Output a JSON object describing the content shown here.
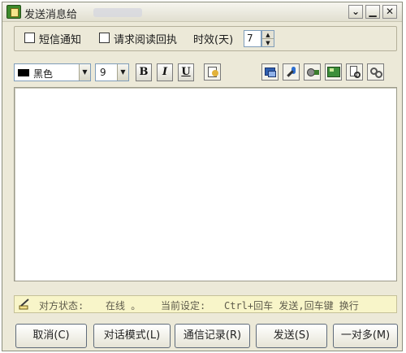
{
  "window": {
    "title": "发送消息给",
    "controls": {
      "menu_glyph": "⌄",
      "minimize_glyph": "▁",
      "close_glyph": "✕"
    }
  },
  "options": {
    "sms_notify_label": "短信通知",
    "read_receipt_label": "请求阅读回执",
    "timeout_label": "时效(天)",
    "timeout_value": "7"
  },
  "format_toolbar": {
    "color_value": "黑色",
    "font_size_value": "9",
    "bold_label": "B",
    "italic_label": "I",
    "underline_label": "U"
  },
  "message": {
    "text": ""
  },
  "status": {
    "peer_label": "对方状态:",
    "peer_value": "在线 。",
    "setting_label": "当前设定:",
    "setting_value": "Ctrl+回车 发送,回车键 换行"
  },
  "buttons": {
    "cancel": "取消(C)",
    "dialog_mode": "对话模式(L)",
    "history": "通信记录(R)",
    "send": "发送(S)",
    "one_to_many": "一对多(M)"
  },
  "icons": {
    "title": "app-green-icon",
    "emoji": "insert-emoticon-icon",
    "screen": "screen-share-icon",
    "mic": "microphone-icon",
    "video": "video-icon",
    "image": "picture-icon",
    "file": "file-transfer-icon",
    "link": "link-icon",
    "status": "pencil-status-icon"
  },
  "colors": {
    "window_bg": "#ece9d8",
    "status_bg": "#f8f5c9",
    "field_border": "#7f9db9"
  }
}
